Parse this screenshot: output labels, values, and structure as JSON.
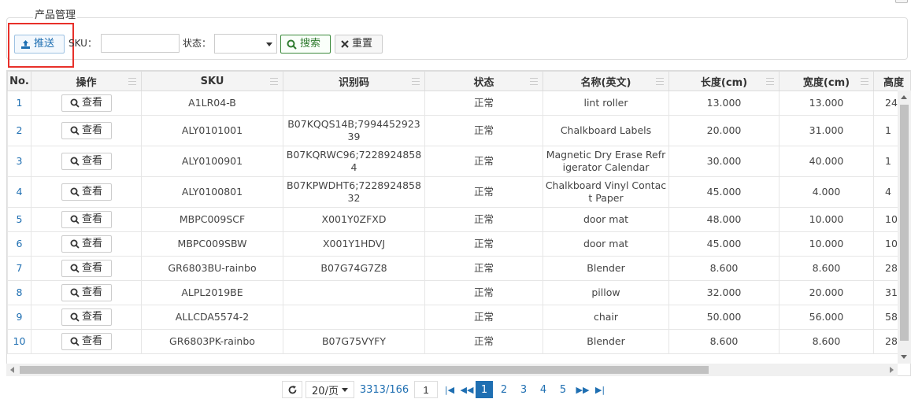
{
  "panel": {
    "legend": "产品管理"
  },
  "toolbar": {
    "push_label": "推送",
    "sku_label": "SKU：",
    "sku_value": "",
    "status_label": "状态：",
    "status_value": "",
    "search_label": "搜索",
    "reset_label": "重置"
  },
  "table": {
    "columns": [
      "No.",
      "操作",
      "SKU",
      "识别码",
      "状态",
      "名称(英文)",
      "长度(cm)",
      "宽度(cm)",
      "高度"
    ],
    "view_label": "查看",
    "rows": [
      {
        "no": "1",
        "sku": "A1LR04-B",
        "code": "",
        "status": "正常",
        "name": "lint roller",
        "length": "13.000",
        "width": "13.000",
        "height": "24"
      },
      {
        "no": "2",
        "sku": "ALY0101001",
        "code": "B07KQQS14B;799445292339",
        "status": "正常",
        "name": "Chalkboard Labels",
        "length": "20.000",
        "width": "31.000",
        "height": "1"
      },
      {
        "no": "3",
        "sku": "ALY0100901",
        "code": "B07KQRWC96;72289248584",
        "status": "正常",
        "name": "Magnetic Dry Erase Refrigerator Calendar",
        "length": "30.000",
        "width": "40.000",
        "height": "1"
      },
      {
        "no": "4",
        "sku": "ALY0100801",
        "code": "B07KPWDHT6;722892485832",
        "status": "正常",
        "name": "Chalkboard Vinyl Contact Paper",
        "length": "45.000",
        "width": "4.000",
        "height": "4"
      },
      {
        "no": "5",
        "sku": "MBPC009SCF",
        "code": "X001Y0ZFXD",
        "status": "正常",
        "name": "door mat",
        "length": "48.000",
        "width": "10.000",
        "height": "10"
      },
      {
        "no": "6",
        "sku": "MBPC009SBW",
        "code": "X001Y1HDVJ",
        "status": "正常",
        "name": "door mat",
        "length": "45.000",
        "width": "10.000",
        "height": "10"
      },
      {
        "no": "7",
        "sku": "GR6803BU-rainbo",
        "code": "B07G74G7Z8",
        "status": "正常",
        "name": "Blender",
        "length": "8.600",
        "width": "8.600",
        "height": "28"
      },
      {
        "no": "8",
        "sku": "ALPL2019BE",
        "code": "",
        "status": "正常",
        "name": "pillow",
        "length": "32.000",
        "width": "20.000",
        "height": "31"
      },
      {
        "no": "9",
        "sku": "ALLCDA5574-2",
        "code": "",
        "status": "正常",
        "name": "chair",
        "length": "50.000",
        "width": "56.000",
        "height": "58"
      },
      {
        "no": "10",
        "sku": "GR6803PK-rainbo",
        "code": "B07G75VYFY",
        "status": "正常",
        "name": "Blender",
        "length": "8.600",
        "width": "8.600",
        "height": "28"
      }
    ]
  },
  "pager": {
    "page_size_label": "20/页",
    "total_label": "3313/166",
    "current_page_input": "1",
    "pages": [
      "1",
      "2",
      "3",
      "4",
      "5"
    ],
    "active_page": "1"
  },
  "colors": {
    "accent": "#1f6fb2",
    "highlight_box": "#e8302a",
    "search_green": "#2f7b2f"
  }
}
